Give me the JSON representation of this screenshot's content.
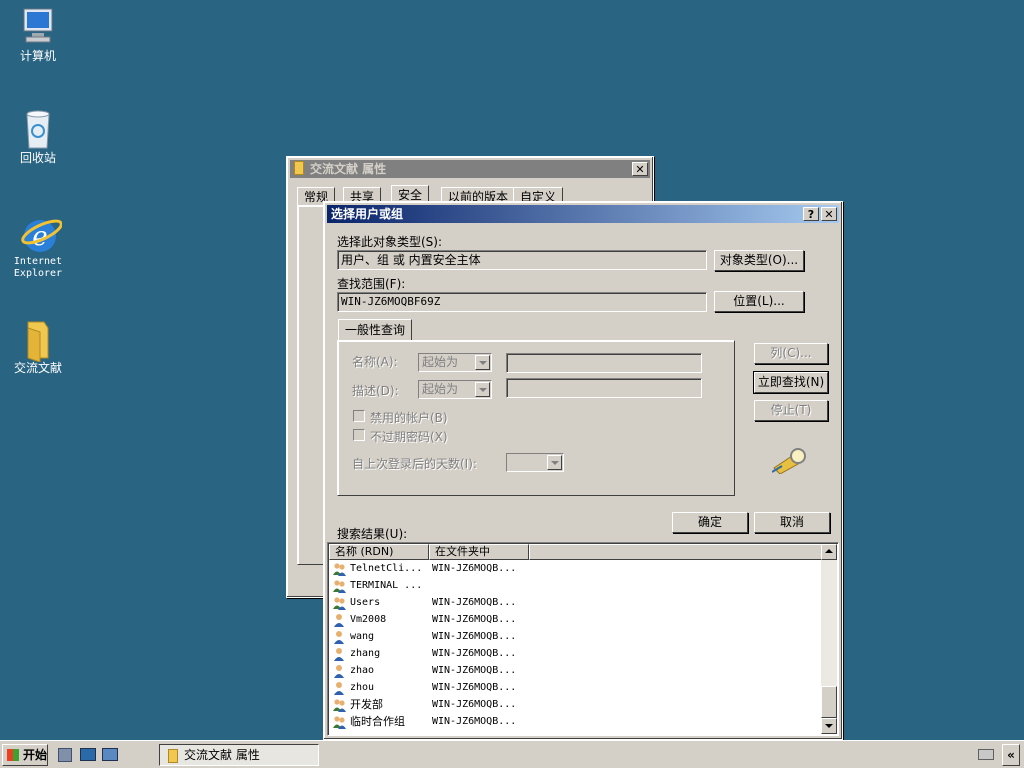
{
  "desktop": {
    "icons": [
      {
        "label": "计算机"
      },
      {
        "label": "回收站"
      },
      {
        "label1": "Internet",
        "label2": "Explorer"
      },
      {
        "label": "交流文献"
      }
    ]
  },
  "props_window": {
    "title": "交流文献 属性",
    "tabs": [
      "常规",
      "共享",
      "安全",
      "以前的版本",
      "自定义"
    ],
    "close": "✕"
  },
  "dialog": {
    "title": "选择用户或组",
    "help": "?",
    "close": "✕",
    "object_type_label": "选择此对象类型(S):",
    "object_type_value": "用户、组 或 内置安全主体",
    "object_type_button": "对象类型(O)...",
    "location_label": "查找范围(F):",
    "location_value": "WIN-JZ6MOQBF69Z",
    "location_button": "位置(L)...",
    "query_tab": "一般性查询",
    "name_label": "名称(A):",
    "name_combo": "起始为",
    "desc_label": "描述(D):",
    "desc_combo": "起始为",
    "disabled_accounts": "禁用的帐户(B)",
    "nonexpiring_pw": "不过期密码(X)",
    "days_since_login": "自上次登录后的天数(I):",
    "columns_button": "列(C)...",
    "find_now_button": "立即查找(N)",
    "stop_button": "停止(T)",
    "ok_button": "确定",
    "cancel_button": "取消",
    "results_label": "搜索结果(U):",
    "columns": [
      "名称 (RDN)",
      "在文件夹中"
    ],
    "rows": [
      {
        "name": "TelnetCli...",
        "folder": "WIN-JZ6MOQB...",
        "kind": "group"
      },
      {
        "name": "TERMINAL ...",
        "folder": "",
        "kind": "group"
      },
      {
        "name": "Users",
        "folder": "WIN-JZ6MOQB...",
        "kind": "group"
      },
      {
        "name": "Vm2008",
        "folder": "WIN-JZ6MOQB...",
        "kind": "user"
      },
      {
        "name": "wang",
        "folder": "WIN-JZ6MOQB...",
        "kind": "user"
      },
      {
        "name": "zhang",
        "folder": "WIN-JZ6MOQB...",
        "kind": "user"
      },
      {
        "name": "zhao",
        "folder": "WIN-JZ6MOQB...",
        "kind": "user"
      },
      {
        "name": "zhou",
        "folder": "WIN-JZ6MOQB...",
        "kind": "user"
      },
      {
        "name": "开发部",
        "folder": "WIN-JZ6MOQB...",
        "kind": "group"
      },
      {
        "name": "临时合作组",
        "folder": "WIN-JZ6MOQB...",
        "kind": "group"
      }
    ]
  },
  "taskbar": {
    "start": "开始",
    "task": "交流文献 属性",
    "tray_arrow": "«"
  }
}
